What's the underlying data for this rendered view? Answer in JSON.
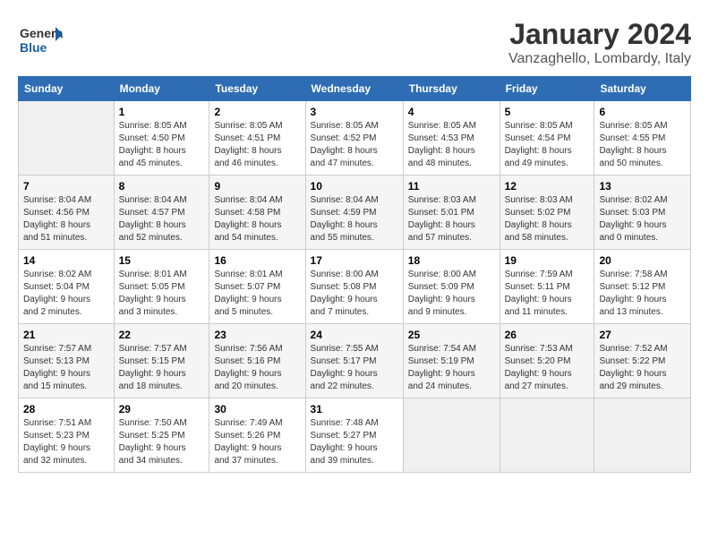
{
  "header": {
    "logo_general": "General",
    "logo_blue": "Blue",
    "title": "January 2024",
    "subtitle": "Vanzaghello, Lombardy, Italy"
  },
  "calendar": {
    "days_of_week": [
      "Sunday",
      "Monday",
      "Tuesday",
      "Wednesday",
      "Thursday",
      "Friday",
      "Saturday"
    ],
    "weeks": [
      [
        {
          "day": "",
          "info": ""
        },
        {
          "day": "1",
          "info": "Sunrise: 8:05 AM\nSunset: 4:50 PM\nDaylight: 8 hours\nand 45 minutes."
        },
        {
          "day": "2",
          "info": "Sunrise: 8:05 AM\nSunset: 4:51 PM\nDaylight: 8 hours\nand 46 minutes."
        },
        {
          "day": "3",
          "info": "Sunrise: 8:05 AM\nSunset: 4:52 PM\nDaylight: 8 hours\nand 47 minutes."
        },
        {
          "day": "4",
          "info": "Sunrise: 8:05 AM\nSunset: 4:53 PM\nDaylight: 8 hours\nand 48 minutes."
        },
        {
          "day": "5",
          "info": "Sunrise: 8:05 AM\nSunset: 4:54 PM\nDaylight: 8 hours\nand 49 minutes."
        },
        {
          "day": "6",
          "info": "Sunrise: 8:05 AM\nSunset: 4:55 PM\nDaylight: 8 hours\nand 50 minutes."
        }
      ],
      [
        {
          "day": "7",
          "info": "Sunrise: 8:04 AM\nSunset: 4:56 PM\nDaylight: 8 hours\nand 51 minutes."
        },
        {
          "day": "8",
          "info": "Sunrise: 8:04 AM\nSunset: 4:57 PM\nDaylight: 8 hours\nand 52 minutes."
        },
        {
          "day": "9",
          "info": "Sunrise: 8:04 AM\nSunset: 4:58 PM\nDaylight: 8 hours\nand 54 minutes."
        },
        {
          "day": "10",
          "info": "Sunrise: 8:04 AM\nSunset: 4:59 PM\nDaylight: 8 hours\nand 55 minutes."
        },
        {
          "day": "11",
          "info": "Sunrise: 8:03 AM\nSunset: 5:01 PM\nDaylight: 8 hours\nand 57 minutes."
        },
        {
          "day": "12",
          "info": "Sunrise: 8:03 AM\nSunset: 5:02 PM\nDaylight: 8 hours\nand 58 minutes."
        },
        {
          "day": "13",
          "info": "Sunrise: 8:02 AM\nSunset: 5:03 PM\nDaylight: 9 hours\nand 0 minutes."
        }
      ],
      [
        {
          "day": "14",
          "info": "Sunrise: 8:02 AM\nSunset: 5:04 PM\nDaylight: 9 hours\nand 2 minutes."
        },
        {
          "day": "15",
          "info": "Sunrise: 8:01 AM\nSunset: 5:05 PM\nDaylight: 9 hours\nand 3 minutes."
        },
        {
          "day": "16",
          "info": "Sunrise: 8:01 AM\nSunset: 5:07 PM\nDaylight: 9 hours\nand 5 minutes."
        },
        {
          "day": "17",
          "info": "Sunrise: 8:00 AM\nSunset: 5:08 PM\nDaylight: 9 hours\nand 7 minutes."
        },
        {
          "day": "18",
          "info": "Sunrise: 8:00 AM\nSunset: 5:09 PM\nDaylight: 9 hours\nand 9 minutes."
        },
        {
          "day": "19",
          "info": "Sunrise: 7:59 AM\nSunset: 5:11 PM\nDaylight: 9 hours\nand 11 minutes."
        },
        {
          "day": "20",
          "info": "Sunrise: 7:58 AM\nSunset: 5:12 PM\nDaylight: 9 hours\nand 13 minutes."
        }
      ],
      [
        {
          "day": "21",
          "info": "Sunrise: 7:57 AM\nSunset: 5:13 PM\nDaylight: 9 hours\nand 15 minutes."
        },
        {
          "day": "22",
          "info": "Sunrise: 7:57 AM\nSunset: 5:15 PM\nDaylight: 9 hours\nand 18 minutes."
        },
        {
          "day": "23",
          "info": "Sunrise: 7:56 AM\nSunset: 5:16 PM\nDaylight: 9 hours\nand 20 minutes."
        },
        {
          "day": "24",
          "info": "Sunrise: 7:55 AM\nSunset: 5:17 PM\nDaylight: 9 hours\nand 22 minutes."
        },
        {
          "day": "25",
          "info": "Sunrise: 7:54 AM\nSunset: 5:19 PM\nDaylight: 9 hours\nand 24 minutes."
        },
        {
          "day": "26",
          "info": "Sunrise: 7:53 AM\nSunset: 5:20 PM\nDaylight: 9 hours\nand 27 minutes."
        },
        {
          "day": "27",
          "info": "Sunrise: 7:52 AM\nSunset: 5:22 PM\nDaylight: 9 hours\nand 29 minutes."
        }
      ],
      [
        {
          "day": "28",
          "info": "Sunrise: 7:51 AM\nSunset: 5:23 PM\nDaylight: 9 hours\nand 32 minutes."
        },
        {
          "day": "29",
          "info": "Sunrise: 7:50 AM\nSunset: 5:25 PM\nDaylight: 9 hours\nand 34 minutes."
        },
        {
          "day": "30",
          "info": "Sunrise: 7:49 AM\nSunset: 5:26 PM\nDaylight: 9 hours\nand 37 minutes."
        },
        {
          "day": "31",
          "info": "Sunrise: 7:48 AM\nSunset: 5:27 PM\nDaylight: 9 hours\nand 39 minutes."
        },
        {
          "day": "",
          "info": ""
        },
        {
          "day": "",
          "info": ""
        },
        {
          "day": "",
          "info": ""
        }
      ]
    ]
  }
}
